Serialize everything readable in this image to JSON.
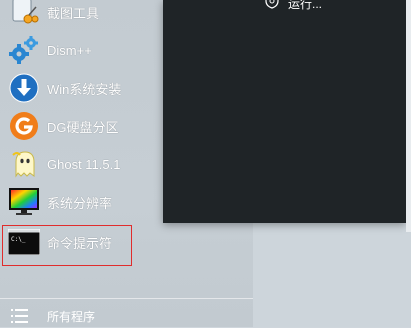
{
  "menu": {
    "items": [
      {
        "label": "截图工具",
        "icon": "scissors-icon"
      },
      {
        "label": "Dism++",
        "icon": "gears-icon"
      },
      {
        "label": "Win系统安装",
        "icon": "download-arrow-icon"
      },
      {
        "label": "DG硬盘分区",
        "icon": "diskgenius-g-icon"
      },
      {
        "label": "Ghost 11.5.1",
        "icon": "ghost-icon"
      },
      {
        "label": "系统分辨率",
        "icon": "display-resolution-icon"
      },
      {
        "label": "命令提示符",
        "icon": "command-prompt-icon"
      }
    ],
    "all_programs": "所有程序"
  },
  "right_panel": {
    "run_label": "运行..."
  },
  "colors": {
    "highlight_border": "#e02c2c",
    "dark_panel": "#1f2427",
    "menu_background": "#c3cbd1"
  }
}
